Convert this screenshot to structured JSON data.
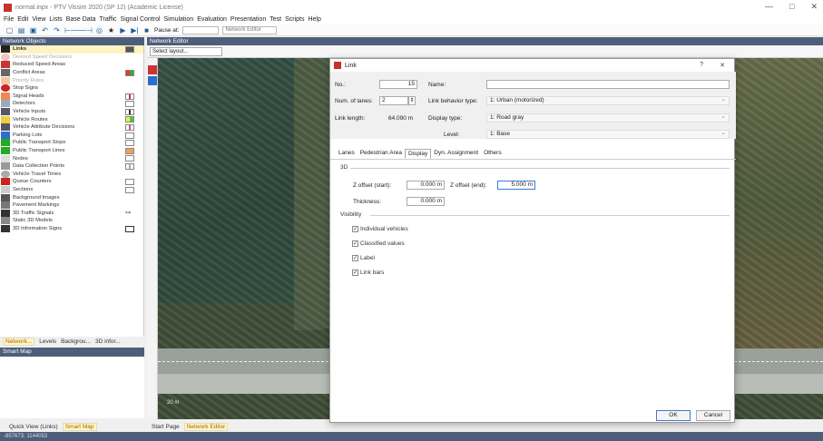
{
  "window": {
    "title": "normal.inpx - PTV Vissim 2020 (SP 12) (Academic License)",
    "controls": [
      "—",
      "□",
      "✕"
    ]
  },
  "menu": [
    "File",
    "Edit",
    "View",
    "Lists",
    "Base Data",
    "Traffic",
    "Signal Control",
    "Simulation",
    "Evaluation",
    "Presentation",
    "Test",
    "Scripts",
    "Help"
  ],
  "toolbar": {
    "pause_label": "Pause at:",
    "editor_select": "Network Editor"
  },
  "network_objects": {
    "header": "Network Objects",
    "items": [
      {
        "label": "Links",
        "selected": true
      },
      {
        "label": "Desired Speed Decisions",
        "dim": true
      },
      {
        "label": "Reduced Speed Areas"
      },
      {
        "label": "Conflict Areas"
      },
      {
        "label": "Priority Rules",
        "dim": true
      },
      {
        "label": "Stop Signs"
      },
      {
        "label": "Signal Heads"
      },
      {
        "label": "Detectors"
      },
      {
        "label": "Vehicle Inputs"
      },
      {
        "label": "Vehicle Routes"
      },
      {
        "label": "Vehicle Attribute Decisions"
      },
      {
        "label": "Parking Lots"
      },
      {
        "label": "Public Transport Stops"
      },
      {
        "label": "Public Transport Lines"
      },
      {
        "label": "Nodes"
      },
      {
        "label": "Data Collection Points"
      },
      {
        "label": "Vehicle Travel Times"
      },
      {
        "label": "Queue Counters"
      },
      {
        "label": "Sections"
      },
      {
        "label": "Background Images"
      },
      {
        "label": "Pavement Markings"
      },
      {
        "label": "3D Traffic Signals"
      },
      {
        "label": "Static 3D Models"
      },
      {
        "label": "3D Information Signs"
      }
    ],
    "tabs": [
      "Network...",
      "Levels",
      "Backgrou...",
      "3D infor..."
    ]
  },
  "smart_map": {
    "header": "Smart Map",
    "tabs": [
      "Quick View (Links)",
      "Smart Map"
    ]
  },
  "editor": {
    "header": "Network Editor",
    "layout_placeholder": "Select layout...",
    "bottom_tabs": [
      "Start Page",
      "Network Editor"
    ],
    "scale_label": "20 m"
  },
  "status_bar": "-857673; 1144053",
  "dialog": {
    "title": "Link",
    "help": "?",
    "close": "✕",
    "no_label": "No.:",
    "no_value": "15",
    "name_label": "Name:",
    "name_value": "",
    "lanes_label": "Num. of lanes:",
    "lanes_value": "2",
    "behavior_label": "Link behavior type:",
    "behavior_value": "1: Urban (motorized)",
    "length_label": "Link length:",
    "length_value": "64.090 m",
    "display_label": "Display type:",
    "display_value": "1: Road gray",
    "level_label": "Level:",
    "level_value": "1: Base",
    "tabs": [
      "Lanes",
      "Pedestrian Area",
      "Display",
      "Dyn. Assignment",
      "Others"
    ],
    "active_tab": "Display",
    "section_3d": "3D",
    "z_start_label": "Z offset (start):",
    "z_start_value": "0.000 m",
    "z_end_label": "Z offset (end):",
    "z_end_value": "5.000 m",
    "thickness_label": "Thickness:",
    "thickness_value": "0.000 m",
    "section_visibility": "Visibility",
    "checks": [
      "Individual vehicles",
      "Classified values",
      "Label",
      "Link bars"
    ],
    "ok": "OK",
    "cancel": "Cancel"
  }
}
